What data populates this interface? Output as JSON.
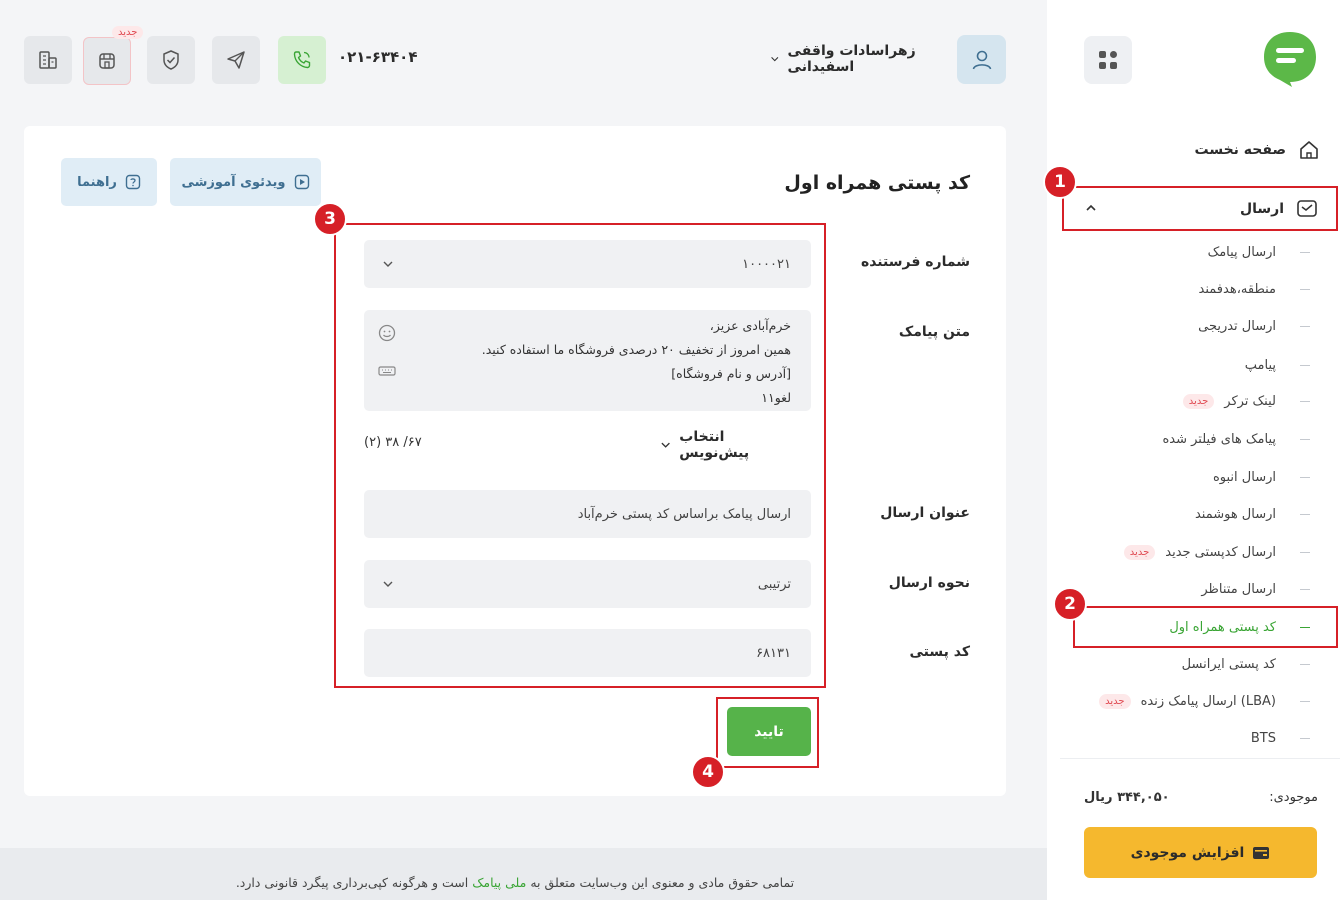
{
  "sidebar": {
    "home_label": "صفحه نخست",
    "send_label": "ارسال",
    "items": [
      {
        "label": "ارسال پیامک",
        "badge": ""
      },
      {
        "label": "منطقه،هدفمند",
        "badge": ""
      },
      {
        "label": "ارسال تدریجی",
        "badge": ""
      },
      {
        "label": "پیامپ",
        "badge": ""
      },
      {
        "label": "لینک ترکر",
        "badge": "جدید"
      },
      {
        "label": "پیامک های فیلتر شده",
        "badge": ""
      },
      {
        "label": "ارسال انبوه",
        "badge": ""
      },
      {
        "label": "ارسال هوشمند",
        "badge": ""
      },
      {
        "label": "ارسال کدپستی جدید",
        "badge": "جدید"
      },
      {
        "label": "ارسال متناظر",
        "badge": ""
      },
      {
        "label": "کد پستی همراه اول",
        "badge": ""
      },
      {
        "label": "کد پستی ایرانسل",
        "badge": ""
      },
      {
        "label": "ارسال پیامک زنده (LBA)",
        "badge": "جدید"
      },
      {
        "label": "BTS",
        "badge": ""
      }
    ],
    "balance_label": "موجودی:",
    "balance_value": "۳۴۴,۰۵۰ ریال",
    "charge_label": "افزایش موجودی"
  },
  "header": {
    "user_name": "زهراسادات واقفی اسفیدانی",
    "phone": "۰۲۱-۶۳۴۰۴",
    "new_badge": "جدید"
  },
  "page": {
    "title": "کد پستی همراه اول",
    "video_label": "ویدئوی آموزشی",
    "guide_label": "راهنما",
    "sender_label": "شماره فرستنده",
    "sender_value": "۱۰۰۰۰۲۱",
    "message_label": "متن پیامک",
    "message_lines": [
      "خرم‌آبادی عزیز،",
      "همین امروز از تخفیف ۲۰ درصدی فروشگاه ما استفاده کنید.",
      "[آدرس و نام فروشگاه]",
      "لغو۱۱"
    ],
    "template_label": "انتخاب پیش‌نویس",
    "counter": "۶۷/ ۳۸ (۲)",
    "title_label": "عنوان ارسال",
    "title_value": "ارسال پیامک براساس کد پستی خرم‌آباد",
    "method_label": "نحوه ارسال",
    "method_value": "ترتیبی",
    "postal_label": "کد پستی",
    "postal_value": "۶۸۱۳۱",
    "confirm_label": "تایید"
  },
  "markers": [
    "1",
    "2",
    "3",
    "4"
  ],
  "footer": {
    "before": "تمامی حقوق مادی و معنوی این وب‌سایت متعلق به",
    "brand": "ملی پیامک",
    "after": "است و هرگونه کپی‌برداری پیگرد قانونی دارد."
  },
  "colors": {
    "accent_green": "#56b34a",
    "annotation_red": "#d62027",
    "charge_yellow": "#f5b82e"
  }
}
